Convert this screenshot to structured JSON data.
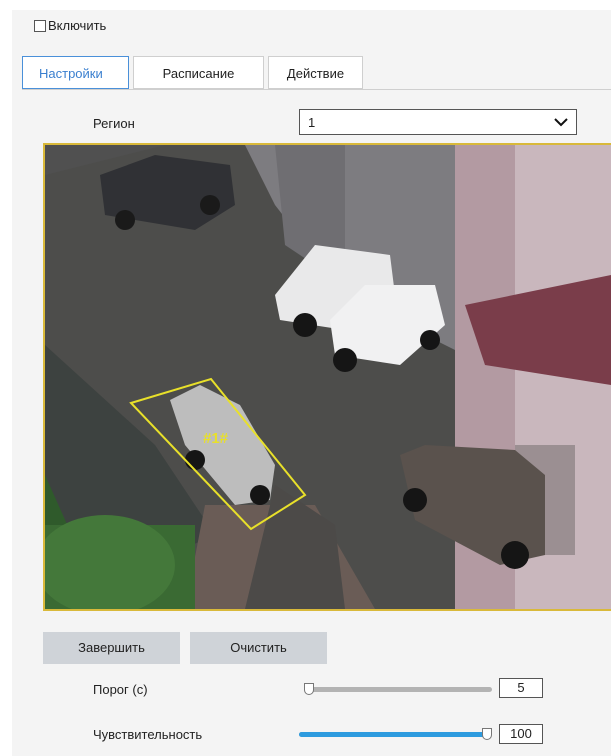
{
  "enable": {
    "label": "Включить",
    "checked": false
  },
  "tabs": [
    {
      "label": "Настройки",
      "active": true
    },
    {
      "label": "Расписание",
      "active": false
    },
    {
      "label": "Действие",
      "active": false
    }
  ],
  "region": {
    "label": "Регион",
    "value": "1"
  },
  "video": {
    "region_marker": "#1#",
    "outline_color": "#e8e02a"
  },
  "buttons": {
    "finish": "Завершить",
    "clear": "Очистить"
  },
  "threshold": {
    "label": "Порог (с)",
    "value": "5",
    "level": 0.0
  },
  "sensitivity": {
    "label": "Чувствительность",
    "value": "100",
    "level": 1.0
  },
  "colors": {
    "accent": "#3a7fcf",
    "slider_fill": "#2d9bdf",
    "button_bg": "#cfd3d8"
  }
}
